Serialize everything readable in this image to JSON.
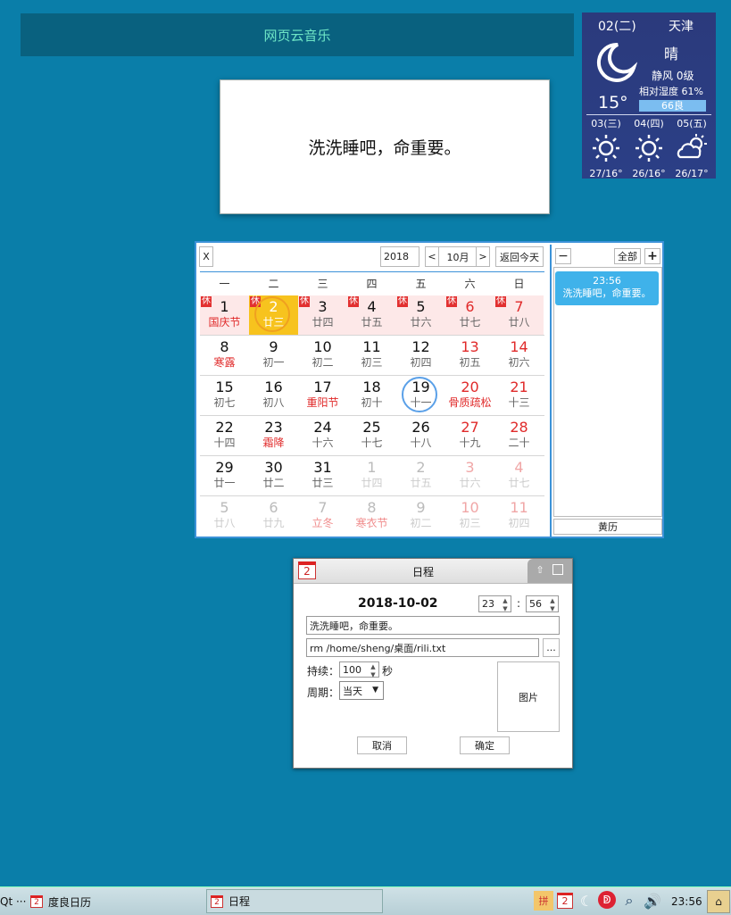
{
  "music_bar": {
    "title": "网页云音乐"
  },
  "reminder": {
    "text": "洗洗睡吧，命重要。"
  },
  "weather": {
    "date": "02(二)",
    "city": "天津",
    "condition": "晴",
    "wind": "静风 0级",
    "humidity": "相对湿度 61%",
    "aqi": "66良",
    "temp": "15°",
    "icon": "moon-icon",
    "forecast": [
      {
        "day": "03(三)",
        "icon": "sun-icon",
        "range": "27/16°"
      },
      {
        "day": "04(四)",
        "icon": "sun-icon",
        "range": "26/16°"
      },
      {
        "day": "05(五)",
        "icon": "cloud-sun-icon",
        "range": "26/17°"
      }
    ]
  },
  "calendar": {
    "close_label": "X",
    "year": "2018",
    "prev_label": "<",
    "month": "10月",
    "next_label": ">",
    "today_label": "返回今天",
    "holiday_tag": "休",
    "weekdays": [
      "一",
      "二",
      "三",
      "四",
      "五",
      "六",
      "日"
    ],
    "weeks": [
      [
        {
          "n": "1",
          "l": "国庆节",
          "fest": 1,
          "hol": 1
        },
        {
          "n": "2",
          "l": "廿三",
          "hol": 1,
          "sel": 1
        },
        {
          "n": "3",
          "l": "廿四",
          "hol": 1
        },
        {
          "n": "4",
          "l": "廿五",
          "hol": 1
        },
        {
          "n": "5",
          "l": "廿六",
          "hol": 1
        },
        {
          "n": "6",
          "l": "廿七",
          "hol": 1,
          "red": 1
        },
        {
          "n": "7",
          "l": "廿八",
          "hol": 1,
          "red": 1
        }
      ],
      [
        {
          "n": "8",
          "l": "寒露",
          "fest": 1
        },
        {
          "n": "9",
          "l": "初一"
        },
        {
          "n": "10",
          "l": "初二"
        },
        {
          "n": "11",
          "l": "初三"
        },
        {
          "n": "12",
          "l": "初四"
        },
        {
          "n": "13",
          "l": "初五",
          "red": 1
        },
        {
          "n": "14",
          "l": "初六",
          "red": 1
        }
      ],
      [
        {
          "n": "15",
          "l": "初七"
        },
        {
          "n": "16",
          "l": "初八"
        },
        {
          "n": "17",
          "l": "重阳节",
          "fest": 1
        },
        {
          "n": "18",
          "l": "初十"
        },
        {
          "n": "19",
          "l": "十一",
          "today": 1
        },
        {
          "n": "20",
          "l": "骨质疏松",
          "red": 1,
          "fest": 1
        },
        {
          "n": "21",
          "l": "十三",
          "red": 1
        }
      ],
      [
        {
          "n": "22",
          "l": "十四"
        },
        {
          "n": "23",
          "l": "霜降",
          "fest": 1
        },
        {
          "n": "24",
          "l": "十六"
        },
        {
          "n": "25",
          "l": "十七"
        },
        {
          "n": "26",
          "l": "十八"
        },
        {
          "n": "27",
          "l": "十九",
          "red": 1
        },
        {
          "n": "28",
          "l": "二十",
          "red": 1
        }
      ],
      [
        {
          "n": "29",
          "l": "廿一"
        },
        {
          "n": "30",
          "l": "廿二"
        },
        {
          "n": "31",
          "l": "廿三"
        },
        {
          "n": "1",
          "l": "廿四",
          "dim": 1
        },
        {
          "n": "2",
          "l": "廿五",
          "dim": 1
        },
        {
          "n": "3",
          "l": "廿六",
          "dim": 1,
          "red": 1
        },
        {
          "n": "4",
          "l": "廿七",
          "dim": 1,
          "red": 1
        }
      ],
      [
        {
          "n": "5",
          "l": "廿八",
          "dim": 1
        },
        {
          "n": "6",
          "l": "廿九",
          "dim": 1
        },
        {
          "n": "7",
          "l": "立冬",
          "dim": 1,
          "fest": 1
        },
        {
          "n": "8",
          "l": "寒衣节",
          "dim": 1,
          "fest": 1
        },
        {
          "n": "9",
          "l": "初二",
          "dim": 1
        },
        {
          "n": "10",
          "l": "初三",
          "dim": 1,
          "red": 1
        },
        {
          "n": "11",
          "l": "初四",
          "dim": 1,
          "red": 1
        }
      ]
    ],
    "panel": {
      "minus": "−",
      "all": "全部",
      "plus": "+",
      "event_time": "23:56",
      "event_text": "洗洗睡吧，命重要。",
      "almanac": "黄历"
    }
  },
  "dialog": {
    "title": "日程",
    "icon_day": "2",
    "date": "2018-10-02",
    "hour": "23",
    "colon": ":",
    "minute": "56",
    "text_value": "洗洗睡吧，命重要。",
    "cmd_value": "rm /home/sheng/桌面/rili.txt",
    "browse": "...",
    "duration_label": "持续：",
    "duration_value": "100",
    "duration_unit": "秒",
    "period_label": "周期：",
    "period_value": "当天",
    "image_label": "图片",
    "cancel": "取消",
    "ok": "确定"
  },
  "taskbar": {
    "left_text": "Qt ···",
    "app1": "度良日历",
    "app2": "日程",
    "cal_day": "2",
    "clock": "23:56"
  }
}
